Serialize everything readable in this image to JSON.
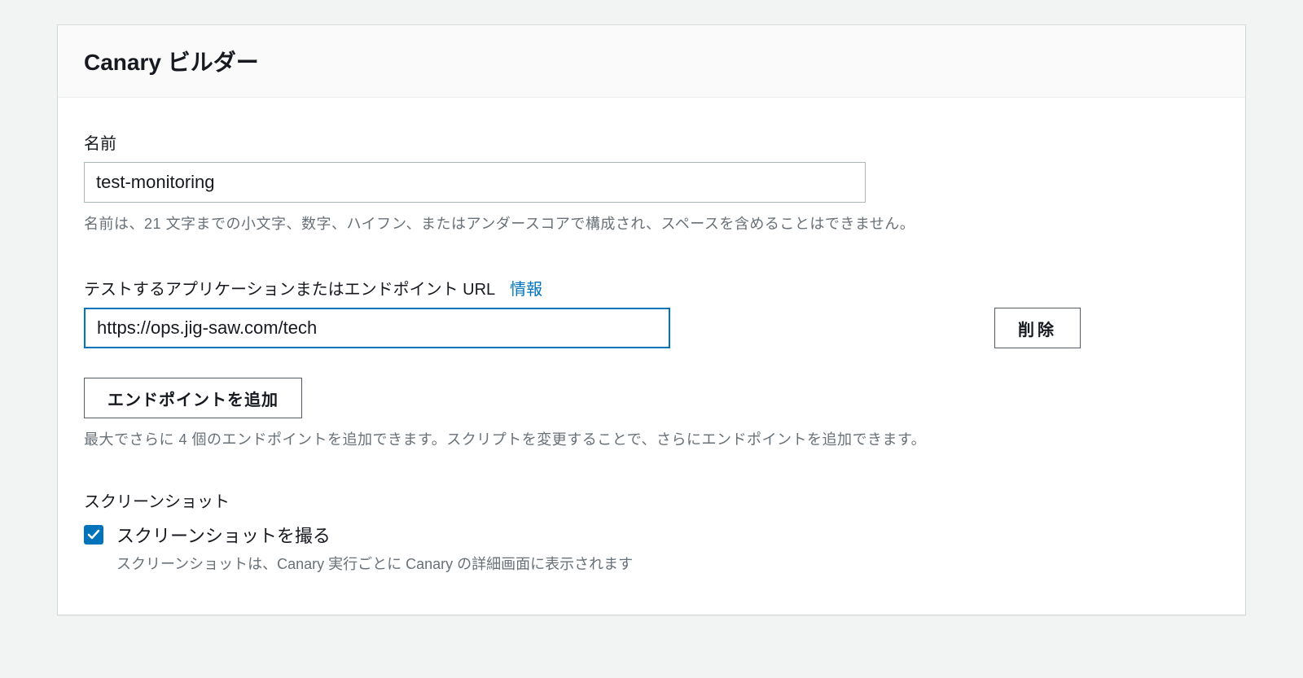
{
  "panel": {
    "title": "Canary ビルダー"
  },
  "name": {
    "label": "名前",
    "value": "test-monitoring",
    "hint": "名前は、21 文字までの小文字、数字、ハイフン、またはアンダースコアで構成され、スペースを含めることはできません。"
  },
  "endpoint": {
    "label": "テストするアプリケーションまたはエンドポイント URL",
    "info": "情報",
    "value": "https://ops.jig-saw.com/tech",
    "delete_label": "削除",
    "add_label": "エンドポイントを追加",
    "hint": "最大でさらに 4 個のエンドポイントを追加できます。スクリプトを変更することで、さらにエンドポイントを追加できます。"
  },
  "screenshot": {
    "section_label": "スクリーンショット",
    "checkbox_label": "スクリーンショットを撮る",
    "checkbox_desc": "スクリーンショットは、Canary 実行ごとに Canary の詳細画面に表示されます",
    "checked": true
  }
}
